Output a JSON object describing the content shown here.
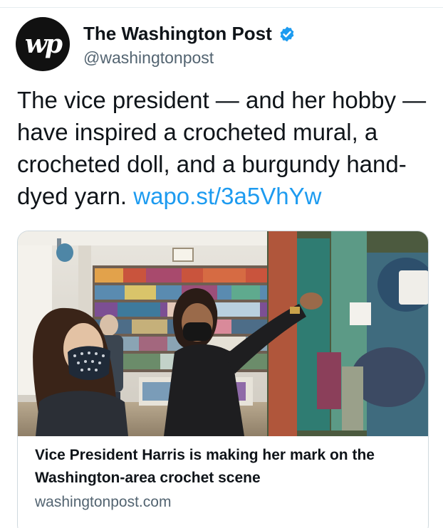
{
  "tweet": {
    "author": {
      "display_name": "The Washington Post",
      "handle": "@washingtonpost",
      "avatar_text": "wp",
      "verified_icon": "verified-badge-icon"
    },
    "text": "The vice president — and her hobby — have inspired a crocheted mural, a crocheted doll, and a burgundy hand-dyed yarn.",
    "link_text": "wapo.st/3a5VhYw"
  },
  "card": {
    "image_name": "harris-yarn-shop-photo",
    "title": "Vice President Harris is making her mark on the Washington-area crochet scene",
    "domain": "washingtonpost.com"
  },
  "colors": {
    "link": "#1d9bf0",
    "verified": "#1d9bf0",
    "secondary_text": "#536471",
    "border": "#cfd9de"
  }
}
